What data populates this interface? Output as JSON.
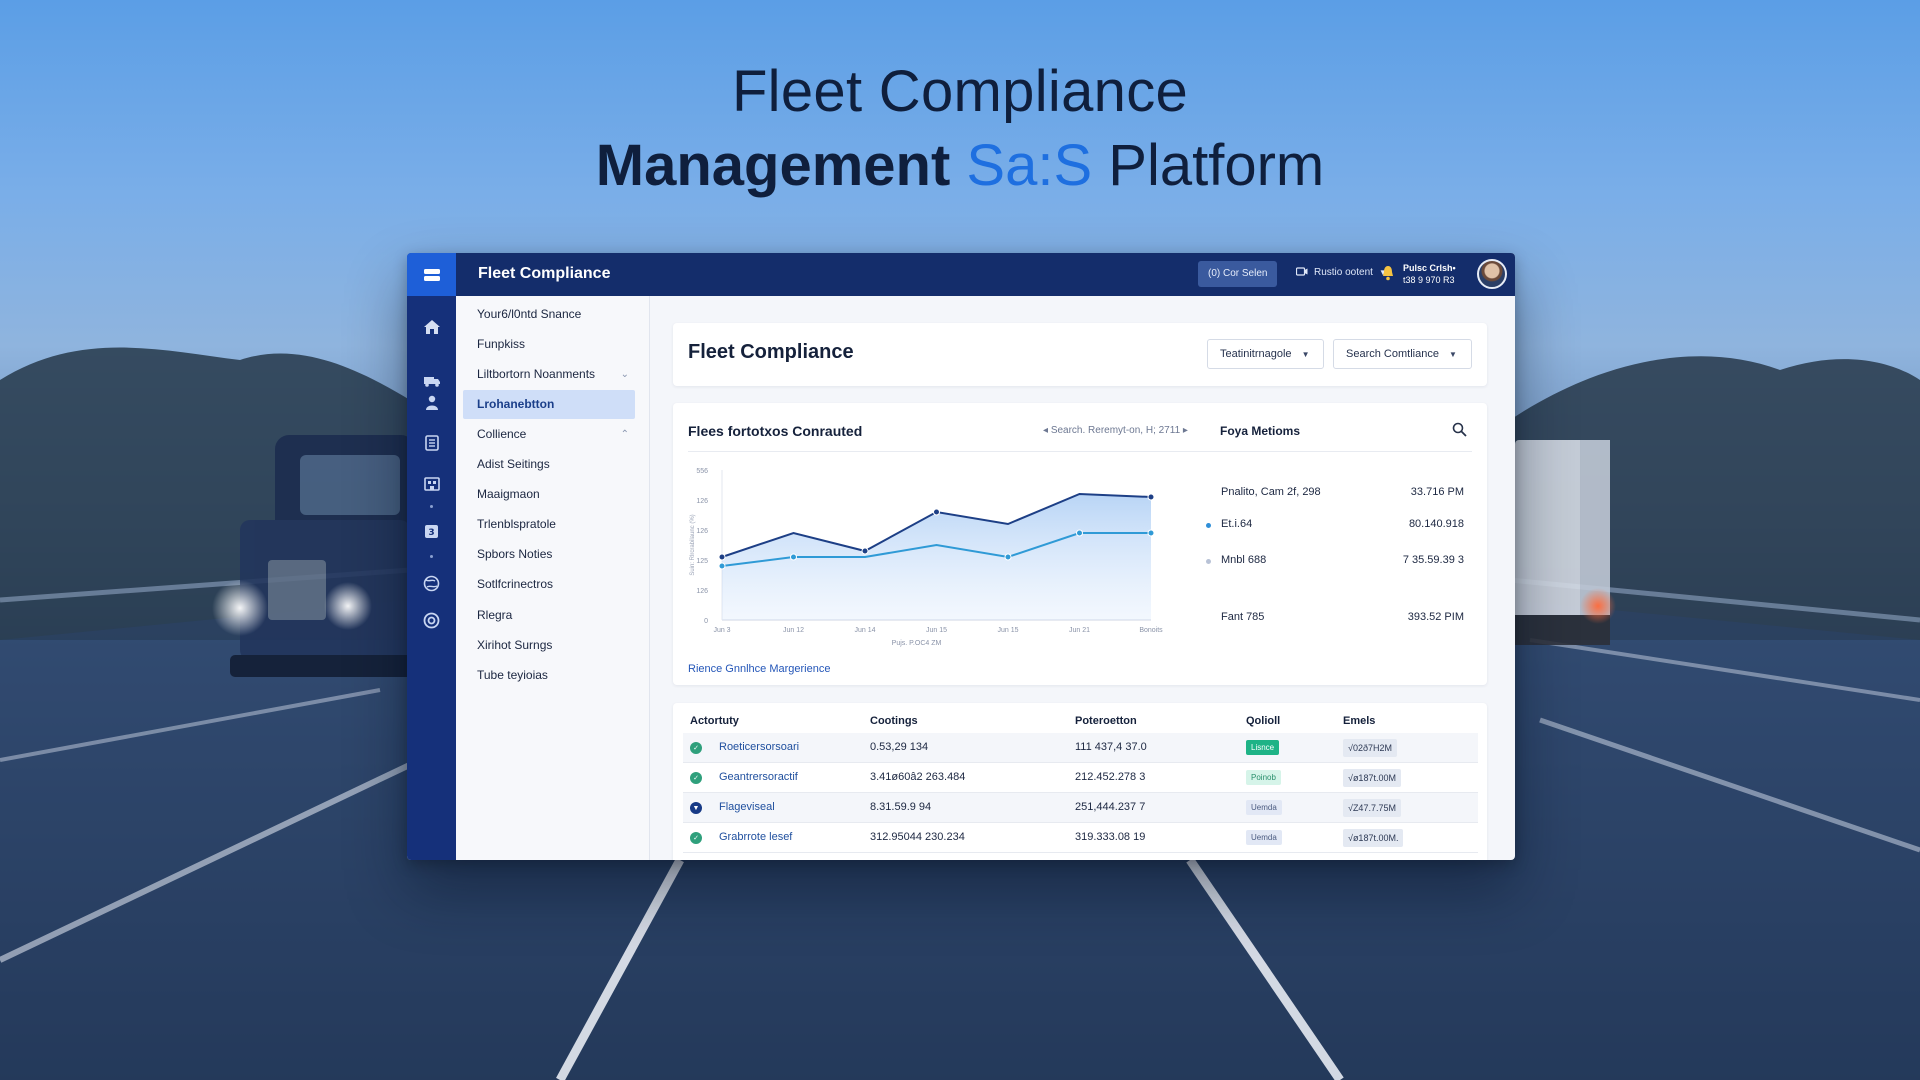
{
  "hero": {
    "line1": "Fleet Compliance",
    "line2_main": "Management",
    "line2_accent": "Sa:S",
    "line2_end": "Platform"
  },
  "topbar": {
    "title": "Fleet Compliance",
    "chip": "(0) Cor Selen",
    "menu": "Rustio ootent",
    "user_name": "Pulsc Crlsh•",
    "user_sub": "t38 9 970 R3"
  },
  "sidebar": {
    "items": [
      {
        "label": "Your6/l0ntd Snance"
      },
      {
        "label": "Funpkiss"
      },
      {
        "label": "Liltbortorn Noanments"
      },
      {
        "label": "Lrohanebtton"
      },
      {
        "label": "Collience"
      },
      {
        "label": "Adist Seitings"
      },
      {
        "label": "Maaigmaon"
      },
      {
        "label": "Trlenblspratole"
      },
      {
        "label": "Spbors Noties"
      },
      {
        "label": "Sotlfcrinectros"
      },
      {
        "label": "Rlegra"
      },
      {
        "label": "Xirihot Surngs"
      },
      {
        "label": "Tube teyioias"
      }
    ]
  },
  "header_panel": {
    "title": "Fleet Compliance",
    "dropdown1": "Teatinitrnagole",
    "dropdown2": "Search Comtliance"
  },
  "chart_panel": {
    "title": "Flees fortotxos Conrauted",
    "range": "Search. Reremyt-on, H; 2711",
    "metrics_title": "Foya Metioms",
    "footer": "Rience Gnnlhce Margerience",
    "metrics": [
      {
        "label": "Pnalito, Cam 2f, 298",
        "value": "33.716 PM",
        "dot": ""
      },
      {
        "label": "Et.i.64",
        "value": "80.140.918",
        "dot": "#2f8fd8"
      },
      {
        "label": "Mnbl 688",
        "value": "7 35.59.39 3",
        "dot": "#b8c2d6"
      },
      {
        "label": "Fant 785",
        "value": "393.52 PIM",
        "dot": ""
      }
    ]
  },
  "chart_data": {
    "type": "line",
    "x": [
      "Jun 3",
      "Jun 12",
      "Jun 14",
      "Jun 15",
      "Jun 15",
      "Jun 21",
      "Bonoits"
    ],
    "xlabel": "Pujs. P.OC4 ZM",
    "ylabel": "Suin: Rlrcrabilaunc (%)",
    "yticks": [
      "0",
      "126",
      "125",
      "126",
      "126",
      "556"
    ],
    "ylim": [
      0,
      5
    ],
    "series": [
      {
        "values": [
          2.1,
          2.9,
          2.3,
          3.6,
          3.2,
          4.2,
          4.1
        ],
        "color": "#1d3f86"
      },
      {
        "values": [
          1.8,
          2.1,
          2.1,
          2.5,
          2.1,
          2.9,
          2.9
        ],
        "color": "#2f9ad6"
      }
    ],
    "grid": false,
    "legend": "none"
  },
  "table": {
    "headers": [
      "Actortuty",
      "Cootings",
      "Poteroetton",
      "Qolioll",
      "Emels"
    ],
    "rows": [
      {
        "name": "Roeticersorsoari",
        "c2": "0.53,29 134",
        "c3": "111 437,4 37.0",
        "badge": "Lisnce",
        "em": "√02ð7H2M",
        "icon_color": "#2fa07c",
        "icon": "✓",
        "badge_bg": "#1eb386",
        "badge_fg": "#ffffff"
      },
      {
        "name": "Geantrersoractif",
        "c2": "3.41ø60â2 263.484",
        "c3": "212.452.278 3",
        "badge": "Poinob",
        "em": "√ø187t.00M",
        "icon_color": "#2fa07c",
        "icon": "✓",
        "badge_bg": "#d6f4e9",
        "badge_fg": "#2a8f6c"
      },
      {
        "name": "Flageviseal",
        "c2": "8.31.59.9 94",
        "c3": "251,444.237 7",
        "badge": "Uemda",
        "em": "√Z47.7.75M",
        "icon_color": "#173a86",
        "icon": "▼",
        "badge_bg": "#e2e8f5",
        "badge_fg": "#4b5b80"
      },
      {
        "name": "Grabrrote lesef",
        "c2": "312.95044 230.234",
        "c3": "319.333.08 19",
        "badge": "Uemda",
        "em": "√ø187t.00M.",
        "icon_color": "#2fa07c",
        "icon": "✓",
        "badge_bg": "#e2e8f5",
        "badge_fg": "#4b5b80"
      }
    ]
  },
  "icons": [
    "menu-logo-icon",
    "home-icon",
    "truck-icon",
    "person-icon",
    "document-icon",
    "building-icon",
    "badge-icon",
    "globe-icon",
    "settings-circle-icon",
    "bell-icon",
    "search-icon"
  ]
}
